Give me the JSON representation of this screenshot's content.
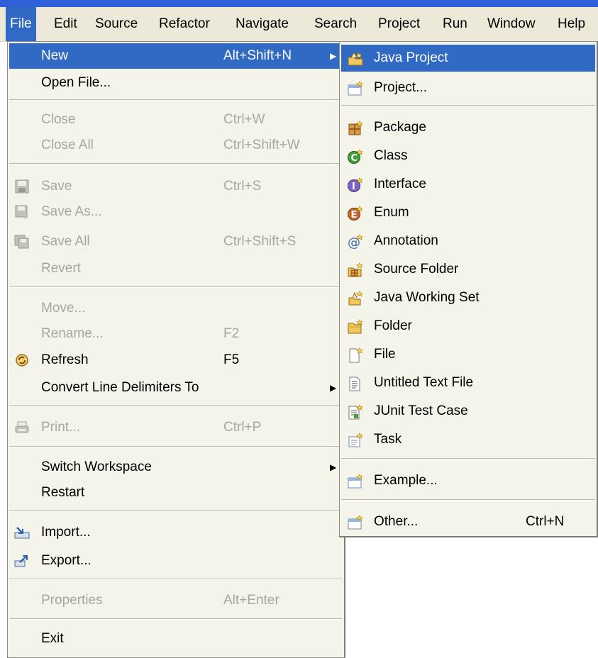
{
  "menubar": {
    "items": [
      "File",
      "Edit",
      "Source",
      "Refactor",
      "Navigate",
      "Search",
      "Project",
      "Run",
      "Window",
      "Help"
    ]
  },
  "file_menu": {
    "items": [
      {
        "label": "New",
        "shortcut": "Alt+Shift+N",
        "submenu": true,
        "highlighted": true
      },
      {
        "label": "Open File..."
      },
      {
        "label": "Close",
        "shortcut": "Ctrl+W",
        "disabled": true
      },
      {
        "label": "Close All",
        "shortcut": "Ctrl+Shift+W",
        "disabled": true
      },
      {
        "label": "Save",
        "shortcut": "Ctrl+S",
        "disabled": true,
        "icon": "save-icon"
      },
      {
        "label": "Save As...",
        "disabled": true,
        "icon": "save-as-icon"
      },
      {
        "label": "Save All",
        "shortcut": "Ctrl+Shift+S",
        "disabled": true,
        "icon": "save-all-icon"
      },
      {
        "label": "Revert",
        "disabled": true
      },
      {
        "label": "Move...",
        "disabled": true
      },
      {
        "label": "Rename...",
        "shortcut": "F2",
        "disabled": true
      },
      {
        "label": "Refresh",
        "shortcut": "F5",
        "icon": "refresh-icon"
      },
      {
        "label": "Convert Line Delimiters To",
        "submenu": true
      },
      {
        "label": "Print...",
        "shortcut": "Ctrl+P",
        "disabled": true,
        "icon": "print-icon"
      },
      {
        "label": "Switch Workspace",
        "submenu": true
      },
      {
        "label": "Restart"
      },
      {
        "label": "Import...",
        "icon": "import-icon"
      },
      {
        "label": "Export...",
        "icon": "export-icon"
      },
      {
        "label": "Properties",
        "shortcut": "Alt+Enter",
        "disabled": true
      },
      {
        "label": "Exit"
      }
    ]
  },
  "new_submenu": {
    "items": [
      {
        "label": "Java Project",
        "icon": "java-project-icon",
        "highlighted": true
      },
      {
        "label": "Project...",
        "icon": "project-icon"
      },
      {
        "label": "Package",
        "icon": "package-icon"
      },
      {
        "label": "Class",
        "icon": "class-icon"
      },
      {
        "label": "Interface",
        "icon": "interface-icon"
      },
      {
        "label": "Enum",
        "icon": "enum-icon"
      },
      {
        "label": "Annotation",
        "icon": "annotation-icon"
      },
      {
        "label": "Source Folder",
        "icon": "source-folder-icon"
      },
      {
        "label": "Java Working Set",
        "icon": "working-set-icon"
      },
      {
        "label": "Folder",
        "icon": "folder-icon"
      },
      {
        "label": "File",
        "icon": "file-icon"
      },
      {
        "label": "Untitled Text File",
        "icon": "text-file-icon"
      },
      {
        "label": "JUnit Test Case",
        "icon": "junit-icon"
      },
      {
        "label": "Task",
        "icon": "task-icon"
      },
      {
        "label": "Example...",
        "icon": "example-icon"
      },
      {
        "label": "Other...",
        "shortcut": "Ctrl+N",
        "icon": "other-icon"
      }
    ]
  },
  "colors": {
    "highlight": "#316ac5",
    "menu_background": "#f5f4ea",
    "menubar_background": "#ece9d8",
    "disabled_text": "#a7a6a0"
  }
}
